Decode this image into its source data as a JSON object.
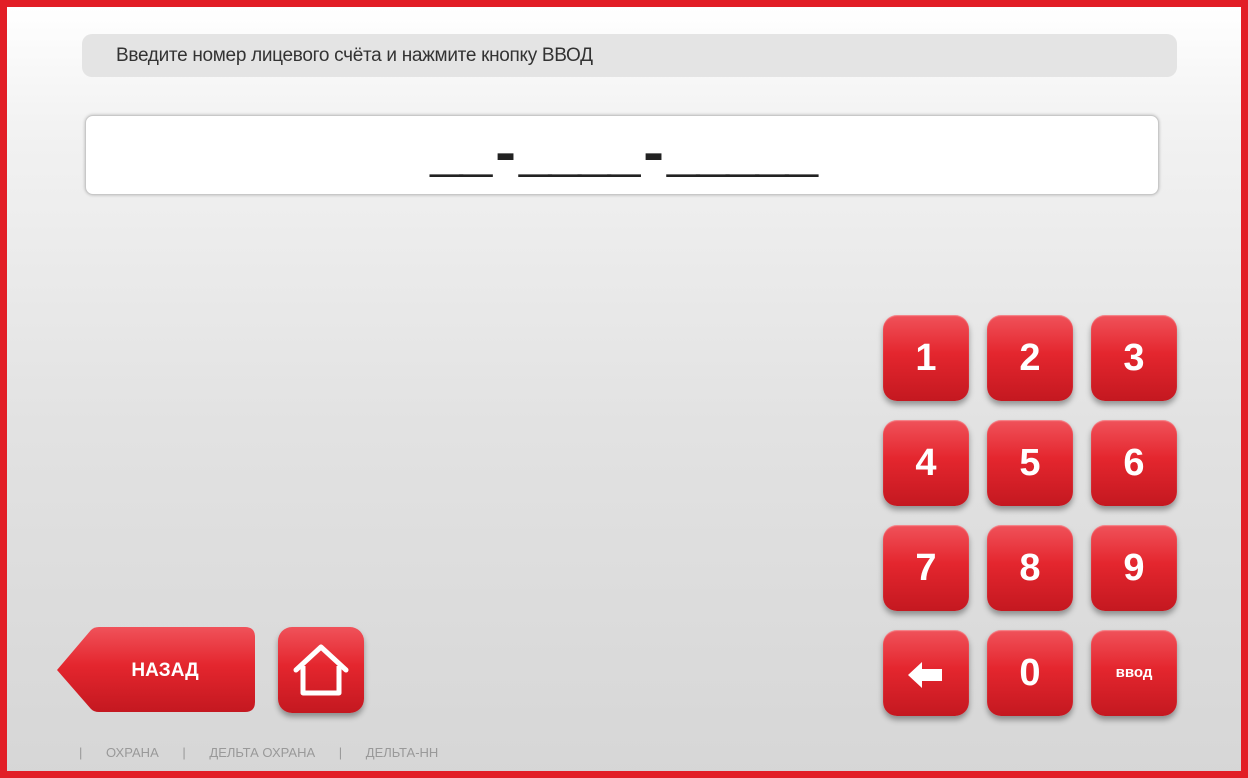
{
  "instruction": {
    "text": "Введите номер лицевого счёта и нажмите кнопку ВВОД"
  },
  "account_input": {
    "mask": "__-____-_____",
    "value": ""
  },
  "keypad": {
    "keys": [
      "1",
      "2",
      "3",
      "4",
      "5",
      "6",
      "7",
      "8",
      "9"
    ],
    "zero": "0",
    "enter": "ввод",
    "backspace_icon": "left-arrow-icon"
  },
  "navigation": {
    "back_label": "НАЗАД",
    "home_icon": "home-icon"
  },
  "footer": {
    "separator": "|",
    "links": [
      "ОХРАНА",
      "ДЕЛЬТА ОХРАНА",
      "ДЕЛЬТА-НН"
    ]
  },
  "colors": {
    "accent": "#e21e26",
    "button_top": "#f0525a",
    "button_bottom": "#c41820",
    "background": "#d6d6d6"
  }
}
